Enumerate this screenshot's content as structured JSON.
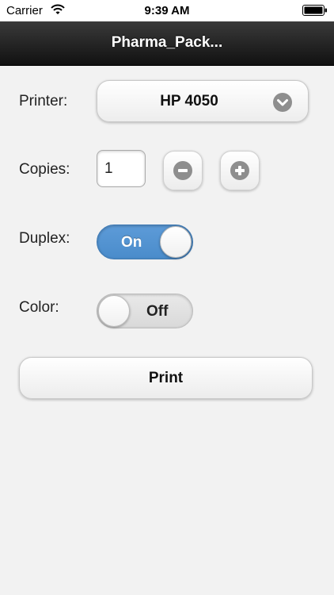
{
  "status_bar": {
    "carrier": "Carrier",
    "time": "9:39 AM",
    "wifi_icon": "wifi-icon",
    "battery_icon": "battery-icon"
  },
  "nav": {
    "title": "Pharma_Pack..."
  },
  "form": {
    "printer": {
      "label": "Printer:",
      "value": "HP 4050",
      "icon": "chevron-down-icon"
    },
    "copies": {
      "label": "Copies:",
      "value": "1",
      "decrement_icon": "minus-icon",
      "increment_icon": "plus-icon"
    },
    "duplex": {
      "label": "Duplex:",
      "state_text": "On",
      "checked": true
    },
    "color": {
      "label": "Color:",
      "state_text": "Off",
      "checked": false
    }
  },
  "actions": {
    "print_label": "Print"
  },
  "colors": {
    "nav_background": "#1f1f1f",
    "page_background": "#f2f2f2",
    "toggle_on": "#4f8fd0",
    "icon_gray": "#8e8e8e"
  }
}
